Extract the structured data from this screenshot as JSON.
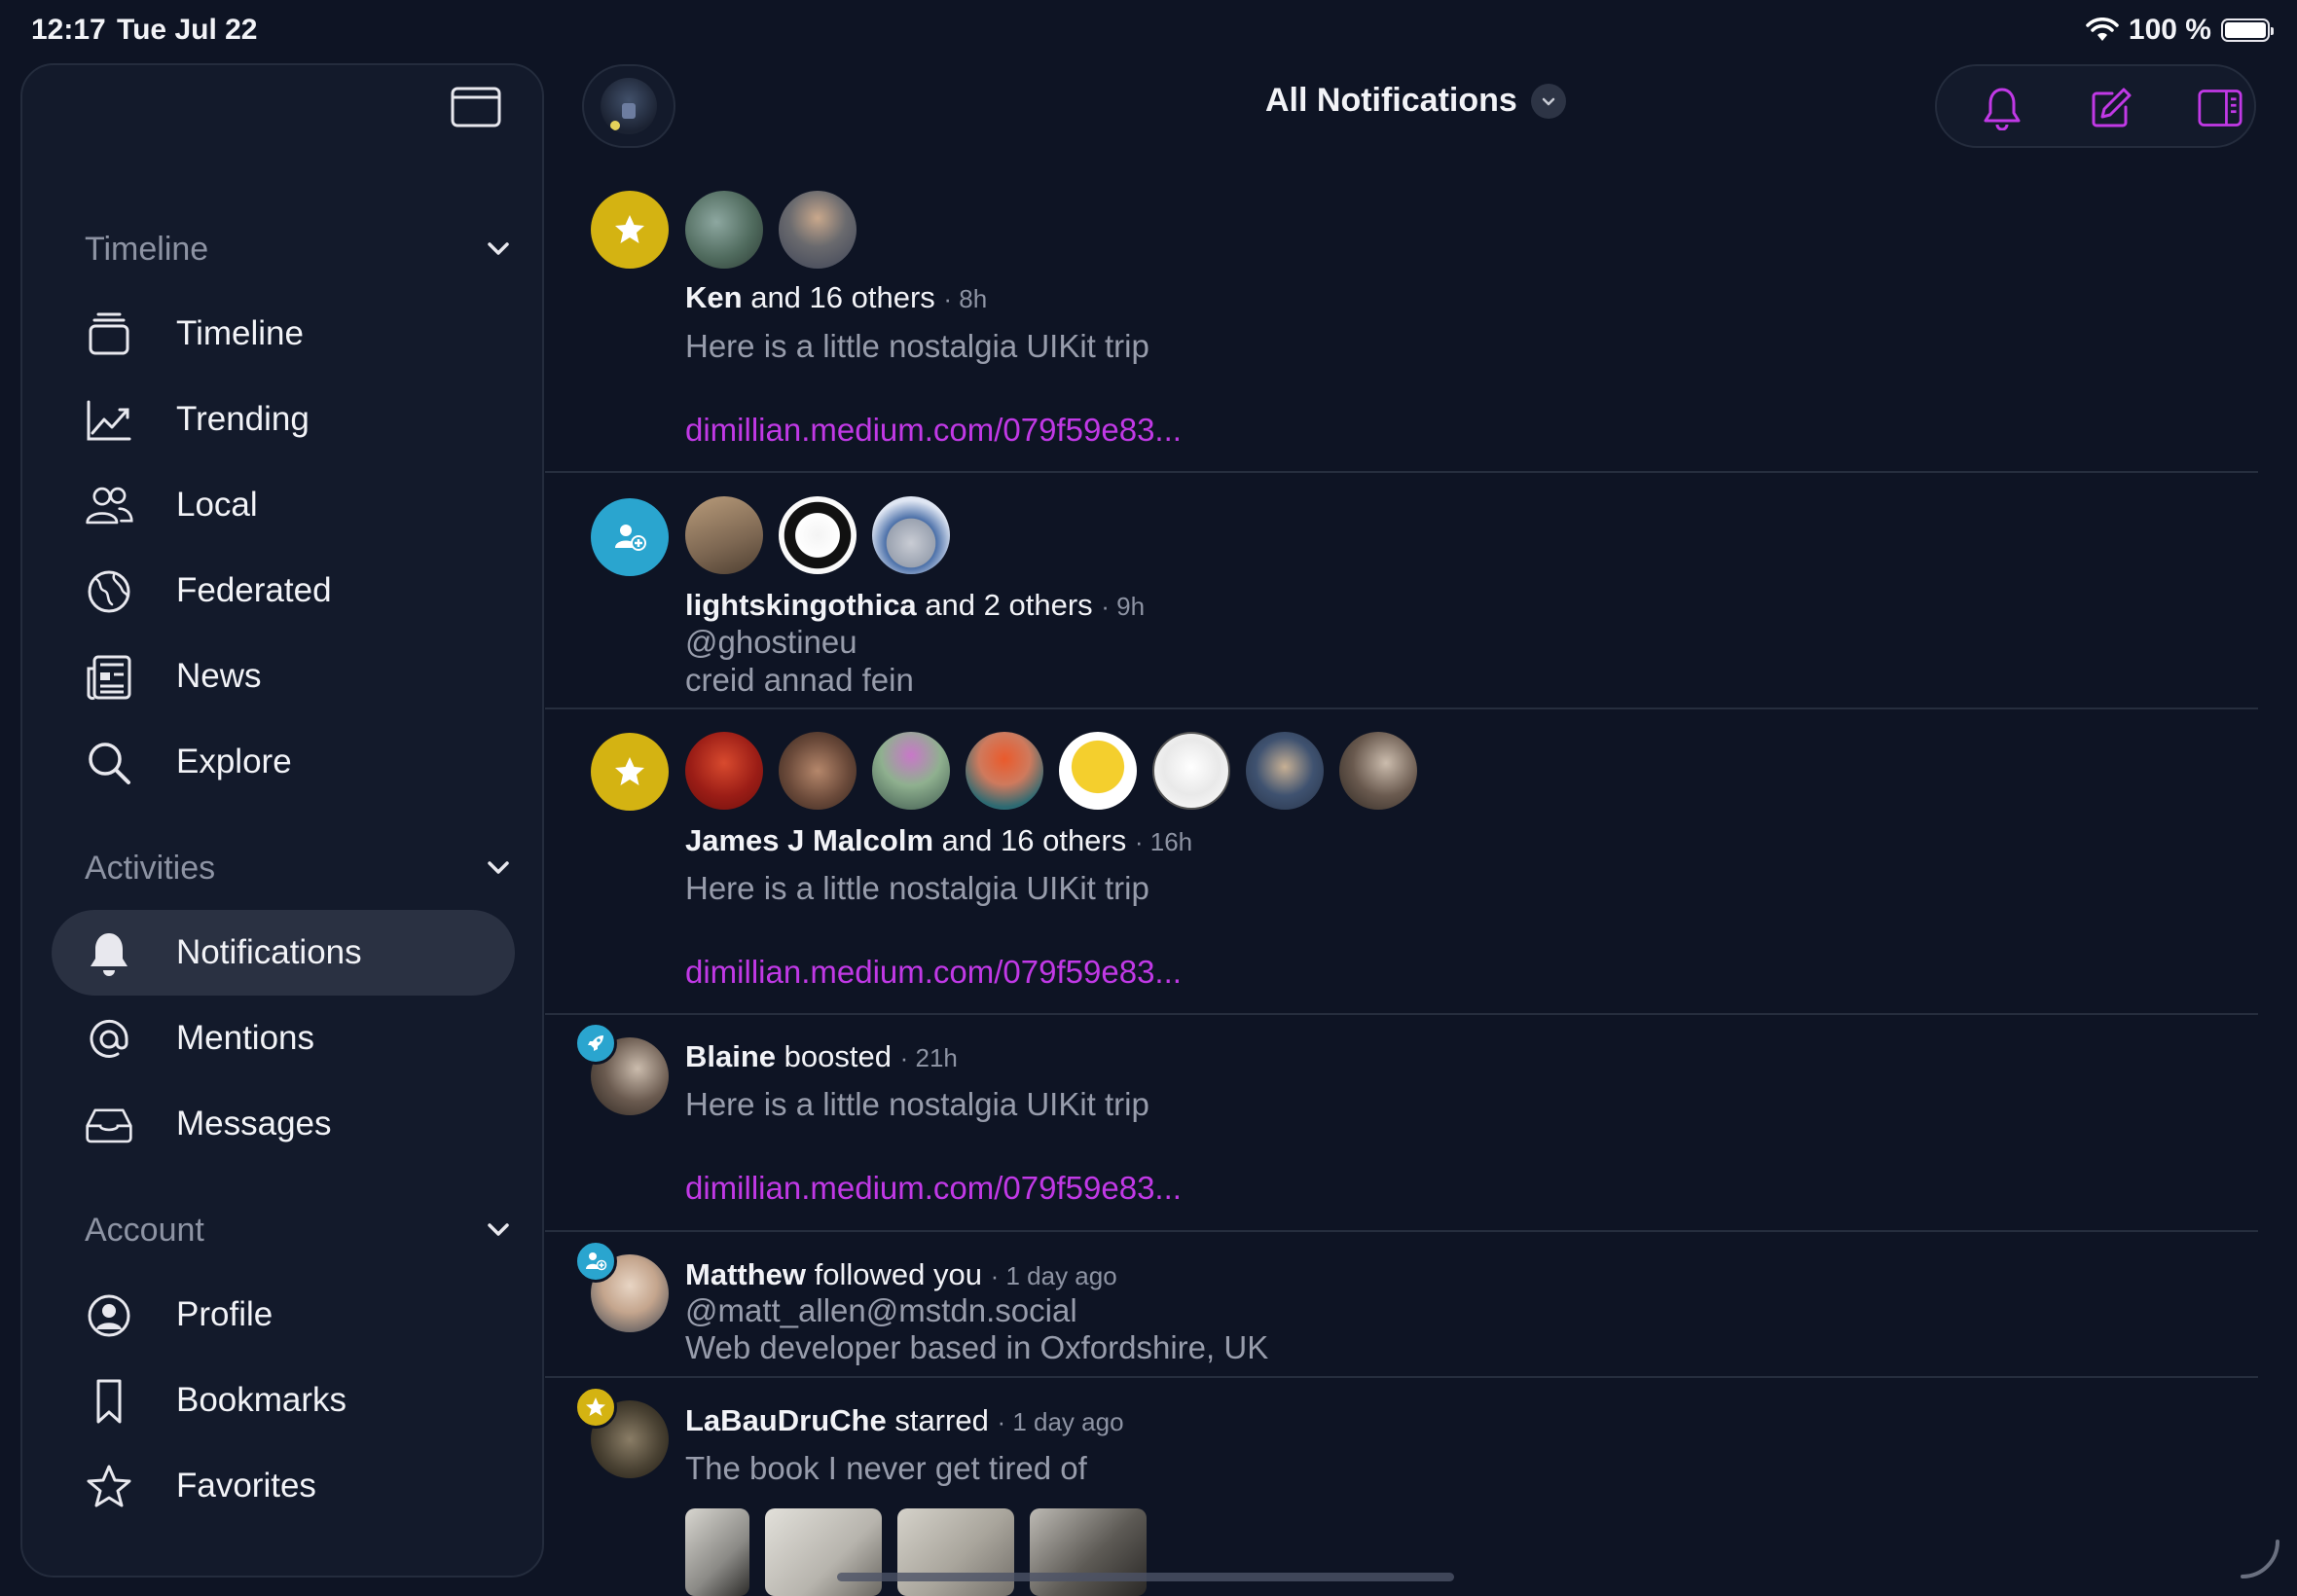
{
  "status_bar": {
    "time": "12:17",
    "date": "Tue Jul 22",
    "battery": "100 %"
  },
  "sidebar": {
    "sections": [
      {
        "title": "Timeline",
        "items": [
          {
            "label": "Timeline",
            "icon": "timeline-icon"
          },
          {
            "label": "Trending",
            "icon": "trending-icon"
          },
          {
            "label": "Local",
            "icon": "people-icon"
          },
          {
            "label": "Federated",
            "icon": "globe-icon"
          },
          {
            "label": "News",
            "icon": "news-icon"
          },
          {
            "label": "Explore",
            "icon": "search-icon"
          }
        ]
      },
      {
        "title": "Activities",
        "items": [
          {
            "label": "Notifications",
            "icon": "bell-icon",
            "active": true
          },
          {
            "label": "Mentions",
            "icon": "at-icon"
          },
          {
            "label": "Messages",
            "icon": "tray-icon"
          }
        ]
      },
      {
        "title": "Account",
        "items": [
          {
            "label": "Profile",
            "icon": "person-circle-icon"
          },
          {
            "label": "Bookmarks",
            "icon": "bookmark-icon"
          },
          {
            "label": "Favorites",
            "icon": "star-icon"
          }
        ]
      }
    ]
  },
  "header": {
    "title": "All Notifications"
  },
  "colors": {
    "accent": "#c139e6",
    "star": "#d4b312",
    "follow": "#2aa5cf",
    "background": "#0e1424"
  },
  "notifications": [
    {
      "type": "favorite",
      "actor": "Ken",
      "others": "and 16 others",
      "time": "· 8h",
      "text": "Here is a little nostalgia UIKit trip",
      "link": "dimillian.medium.com/079f59e83..."
    },
    {
      "type": "follow",
      "actor": "lightskingothica",
      "others": "and 2 others",
      "time": "· 9h",
      "handle": "@ghostineu",
      "text": "creid annad fein"
    },
    {
      "type": "favorite",
      "actor": "James J Malcolm",
      "others": "and 16 others",
      "time": "· 16h",
      "text": "Here is a little nostalgia UIKit trip",
      "link": "dimillian.medium.com/079f59e83..."
    },
    {
      "type": "boost",
      "actor": "Blaine",
      "action": "boosted",
      "time": "· 21h",
      "text": "Here is a little nostalgia UIKit trip",
      "link": "dimillian.medium.com/079f59e83..."
    },
    {
      "type": "follow",
      "actor": "Matthew",
      "action": "followed you",
      "time": "· 1 day ago",
      "handle": "@matt_allen@mstdn.social",
      "text": "Web developer based in Oxfordshire, UK"
    },
    {
      "type": "favorite",
      "actor": "LaBauDruChe",
      "action": "starred",
      "time": "· 1 day ago",
      "text": "The book I never get tired of"
    }
  ]
}
